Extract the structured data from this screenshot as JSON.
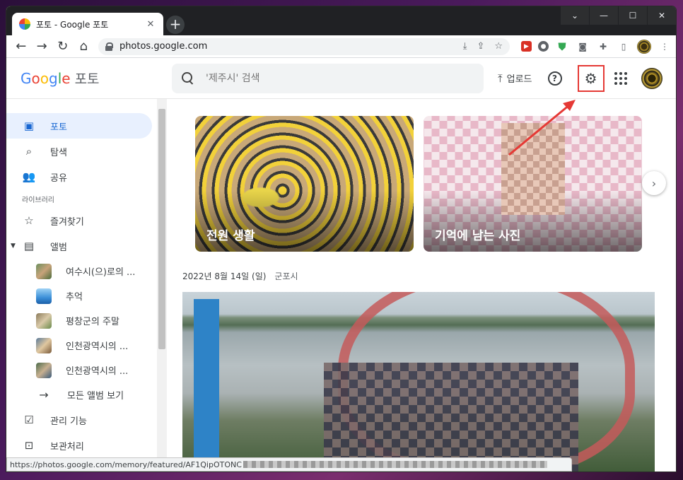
{
  "browser": {
    "tab_title": "포토 - Google 포토",
    "tab_close": "✕",
    "new_tab": "+",
    "url": "photos.google.com",
    "status_url": "https://photos.google.com/memory/featured/AF1QipOTONC"
  },
  "header": {
    "logo_google": [
      "G",
      "o",
      "o",
      "g",
      "l",
      "e"
    ],
    "logo_product": "포토",
    "search_placeholder": "'제주시' 검색",
    "upload_label": "업로드"
  },
  "sidebar": {
    "items": [
      {
        "label": "포토",
        "icon": "photo-icon"
      },
      {
        "label": "탐색",
        "icon": "search-icon"
      },
      {
        "label": "공유",
        "icon": "people-icon"
      }
    ],
    "library_label": "라이브러리",
    "favorites": "즐겨찾기",
    "albums": "앨범",
    "album_list": [
      "여수시(으)로의 ...",
      "추억",
      "평창군의 주말",
      "인천광역시의 ...",
      "인천광역시의 ..."
    ],
    "all_albums": "모든 앨범 보기",
    "manage": "관리 기능",
    "archive": "보관처리"
  },
  "main": {
    "memories": [
      {
        "title": "전원 생활"
      },
      {
        "title": "기억에 남는 사진"
      }
    ],
    "date": "2022년 8월 14일 (일)",
    "place": "군포시"
  },
  "colors": {
    "accent": "#1967d2",
    "highlight": "#e53935"
  }
}
